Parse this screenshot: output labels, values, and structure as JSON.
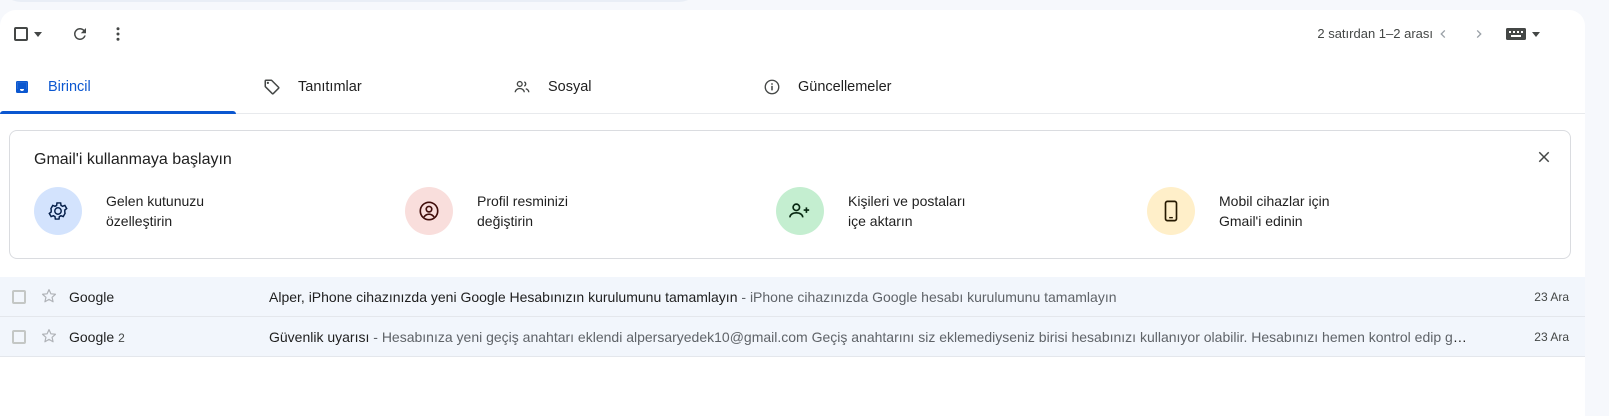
{
  "toolbar": {
    "pager_text": "2 satırdan 1–2 arası"
  },
  "tabs": [
    {
      "label": "Birincil",
      "icon": "inbox-icon",
      "active": true
    },
    {
      "label": "Tanıtımlar",
      "icon": "tag-icon",
      "active": false
    },
    {
      "label": "Sosyal",
      "icon": "people-icon",
      "active": false
    },
    {
      "label": "Güncellemeler",
      "icon": "info-icon",
      "active": false
    }
  ],
  "onboarding": {
    "title": "Gmail'i kullanmaya başlayın",
    "steps": [
      {
        "line1": "Gelen kutunuzu",
        "line2": "özelleştirin",
        "icon": "gear-icon",
        "color": "#d3e3fd"
      },
      {
        "line1": "Profil resminizi",
        "line2": "değiştirin",
        "icon": "account-circle-icon",
        "color": "#f9dedc"
      },
      {
        "line1": "Kişileri ve postaları",
        "line2": "içe aktarın",
        "icon": "person-add-icon",
        "color": "#c4eed0"
      },
      {
        "line1": "Mobil cihazlar için",
        "line2": "Gmail'i edinin",
        "icon": "smartphone-icon",
        "color": "#ffefc9"
      }
    ]
  },
  "mails": [
    {
      "sender": "Google",
      "count": "",
      "subject": "Alper, iPhone cihazınızda yeni Google Hesabınızın kurulumunu tamamlayın",
      "snippet": " - iPhone cihazınızda Google hesabı kurulumunu tamamlayın",
      "date": "23 Ara"
    },
    {
      "sender": "Google",
      "count": "2",
      "subject": "Güvenlik uyarısı",
      "snippet": " - Hesabınıza yeni geçiş anahtarı eklendi alpersaryedek10@gmail.com Geçiş anahtarını siz eklemediyseniz birisi hesabınızı kullanıyor olabilir. Hesabınızı hemen kontrol edip gü...",
      "date": "23 Ara"
    }
  ],
  "colors": {
    "accent": "#0b57d0",
    "row_bg": "#f2f6fc"
  }
}
